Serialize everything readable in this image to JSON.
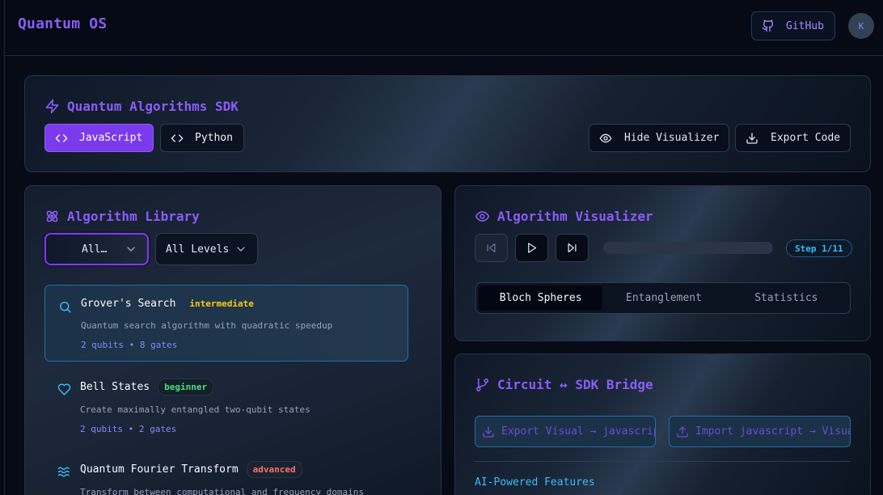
{
  "app": {
    "brand": "Quantum OS",
    "github_label": "GitHub",
    "avatar_initial": "K"
  },
  "sdk": {
    "title": "Quantum Algorithms SDK",
    "languages": [
      {
        "label": "JavaScript",
        "active": true
      },
      {
        "label": "Python",
        "active": false
      }
    ],
    "hide_visualizer_label": "Hide Visualizer",
    "export_code_label": "Export Code"
  },
  "library": {
    "title": "Algorithm Library",
    "category_filter": "All…",
    "level_filter": "All Levels",
    "algorithms": [
      {
        "name": "Grover's Search",
        "level": "intermediate",
        "description": "Quantum search algorithm with quadratic speedup",
        "meta": "2 qubits • 8 gates",
        "selected": true,
        "icon": "search-icon"
      },
      {
        "name": "Bell States",
        "level": "beginner",
        "description": "Create maximally entangled two-qubit states",
        "meta": "2 qubits • 2 gates",
        "selected": false,
        "icon": "heart-icon"
      },
      {
        "name": "Quantum Fourier Transform",
        "level": "advanced",
        "description": "Transform between computational and frequency domains",
        "meta": "",
        "selected": false,
        "icon": "waves-icon"
      }
    ]
  },
  "visualizer": {
    "title": "Algorithm Visualizer",
    "step_label": "Step 1/11",
    "progress": 0.0,
    "tabs": [
      {
        "label": "Bloch Spheres",
        "active": true
      },
      {
        "label": "Entanglement",
        "active": false
      },
      {
        "label": "Statistics",
        "active": false
      }
    ]
  },
  "bridge": {
    "title": "Circuit ↔ SDK Bridge",
    "export_label": "Export Visual → javascript",
    "import_label": "Import javascript → Visual",
    "ai_title": "AI-Powered Features"
  },
  "colors": {
    "accent": "#7c3aed",
    "accent_text": "#8b5cf6",
    "cyan": "#38bdf8",
    "background": "#060b16"
  }
}
